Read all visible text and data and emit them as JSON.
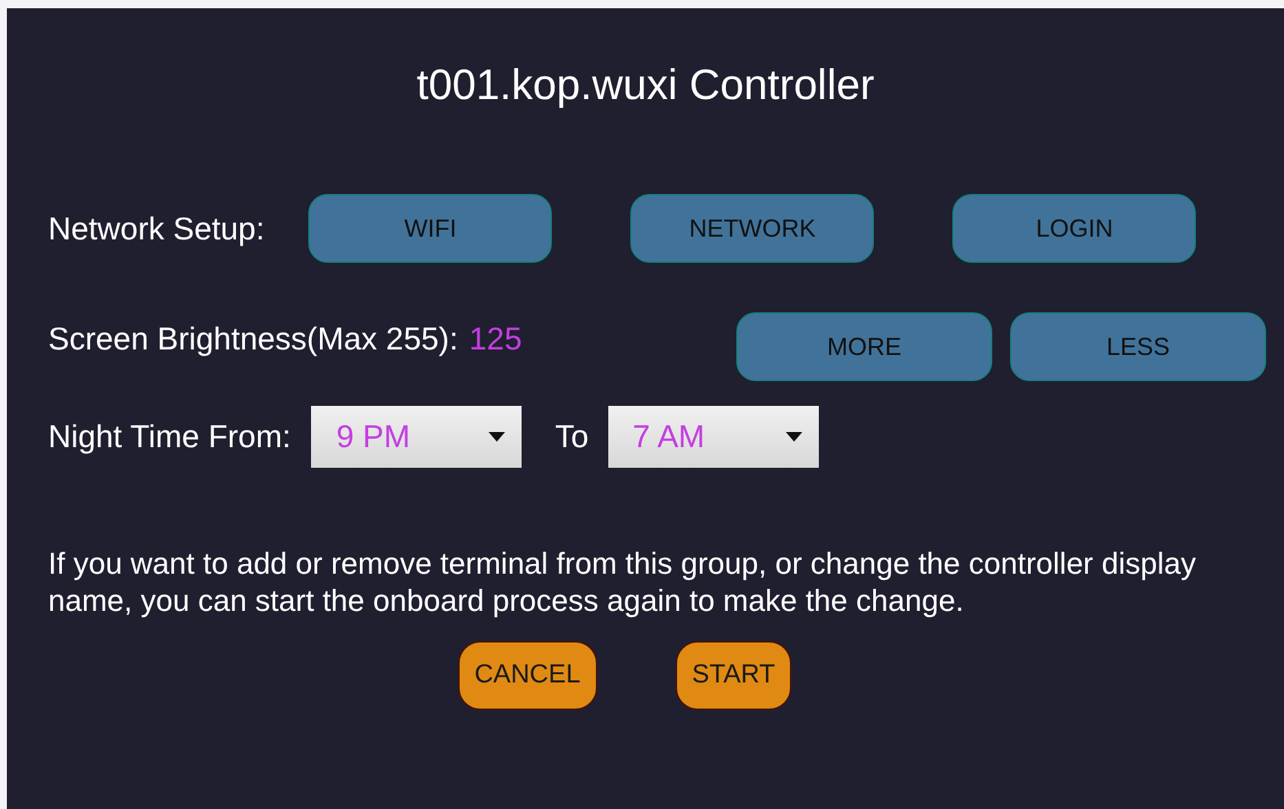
{
  "title": "t001.kop.wuxi Controller",
  "network": {
    "label": "Network Setup:",
    "buttons": [
      "WIFI",
      "NETWORK",
      "LOGIN"
    ]
  },
  "brightness": {
    "label": "Screen Brightness(Max 255):",
    "value": "125",
    "buttons": [
      "MORE",
      "LESS"
    ]
  },
  "night": {
    "label": "Night Time From:",
    "from": "9 PM",
    "to_label": "To",
    "to": "7 AM"
  },
  "message": "If you want to add or remove terminal from this group, or change the controller display name, you can start the onboard process again to make the change.",
  "actions": [
    "CANCEL",
    "START"
  ]
}
